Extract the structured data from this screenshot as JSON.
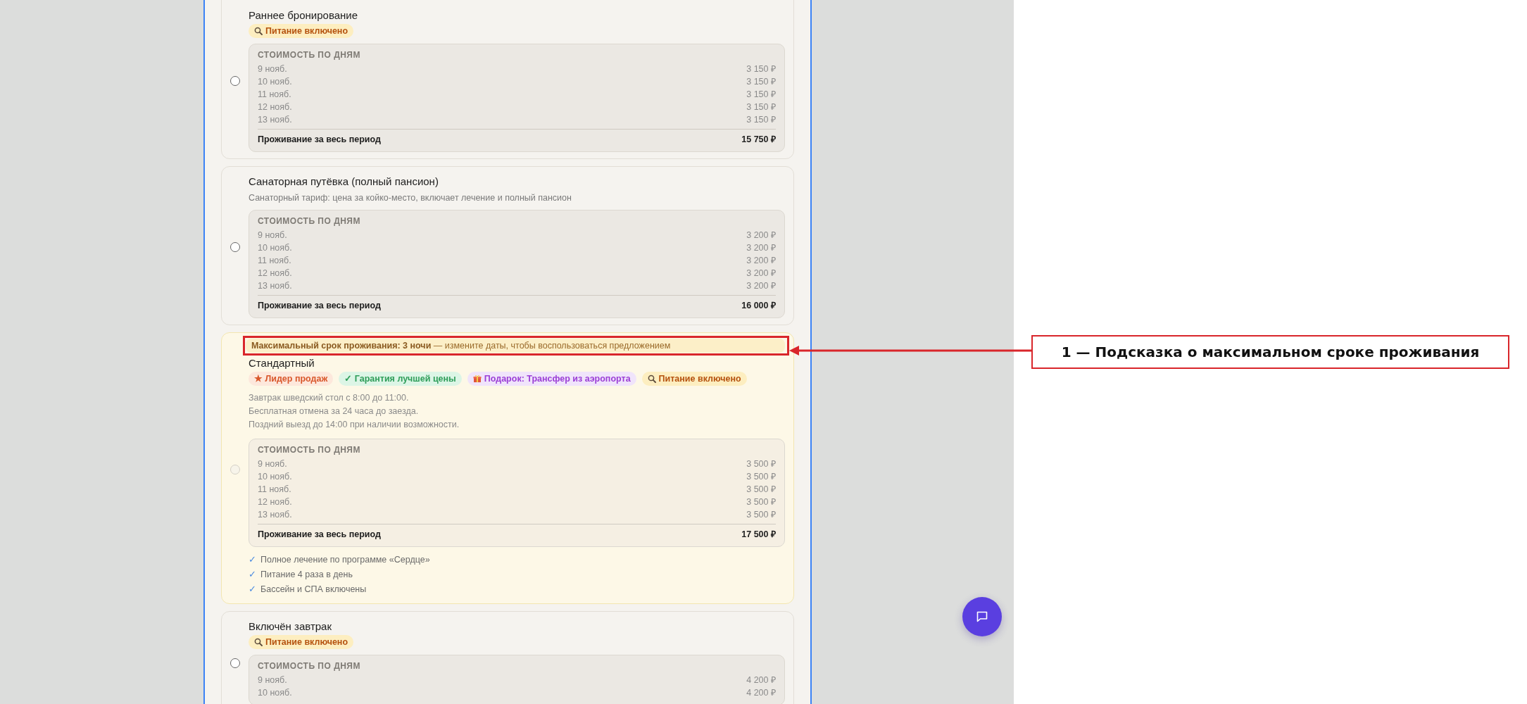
{
  "rates": [
    {
      "title": "Раннее бронирование",
      "selected": false,
      "disabled": false,
      "badges": [
        {
          "kind": "meal",
          "text": "Питание включено"
        }
      ],
      "prices": {
        "heading": "СТОИМОСТЬ ПО ДНЯМ",
        "days": [
          {
            "date": "9 нояб.",
            "price": "3 150 ₽"
          },
          {
            "date": "10 нояб.",
            "price": "3 150 ₽"
          },
          {
            "date": "11 нояб.",
            "price": "3 150 ₽"
          },
          {
            "date": "12 нояб.",
            "price": "3 150 ₽"
          },
          {
            "date": "13 нояб.",
            "price": "3 150 ₽"
          }
        ],
        "total_label": "Проживание за весь период",
        "total": "15 750 ₽"
      }
    },
    {
      "title": "Санаторная путёвка (полный пансион)",
      "selected": false,
      "disabled": false,
      "subtitle": "Санаторный тариф: цена за койко-место, включает лечение и полный пансион",
      "prices": {
        "heading": "СТОИМОСТЬ ПО ДНЯМ",
        "days": [
          {
            "date": "9 нояб.",
            "price": "3 200 ₽"
          },
          {
            "date": "10 нояб.",
            "price": "3 200 ₽"
          },
          {
            "date": "11 нояб.",
            "price": "3 200 ₽"
          },
          {
            "date": "12 нояб.",
            "price": "3 200 ₽"
          },
          {
            "date": "13 нояб.",
            "price": "3 200 ₽"
          }
        ],
        "total_label": "Проживание за весь период",
        "total": "16 000 ₽"
      }
    },
    {
      "title": "Стандартный",
      "selected": false,
      "disabled": true,
      "hint": {
        "label": "Максимальный срок проживания: 3 ночи",
        "text": "— измените даты, чтобы воспользоваться предложением"
      },
      "badges": [
        {
          "kind": "bestseller",
          "text": "★ Лидер продаж"
        },
        {
          "kind": "guarantee",
          "text": "✓ Гарантия лучшей цены"
        },
        {
          "kind": "gift",
          "text": "Подарок: Трансфер из аэропорта"
        },
        {
          "kind": "meal",
          "text": "Питание включено"
        }
      ],
      "description": [
        "Завтрак шведский стол с 8:00 до 11:00.",
        "Бесплатная отмена за 24 часа до заезда.",
        "Поздний выезд до 14:00 при наличии возможности."
      ],
      "prices": {
        "heading": "СТОИМОСТЬ ПО ДНЯМ",
        "days": [
          {
            "date": "9 нояб.",
            "price": "3 500 ₽"
          },
          {
            "date": "10 нояб.",
            "price": "3 500 ₽"
          },
          {
            "date": "11 нояб.",
            "price": "3 500 ₽"
          },
          {
            "date": "12 нояб.",
            "price": "3 500 ₽"
          },
          {
            "date": "13 нояб.",
            "price": "3 500 ₽"
          }
        ],
        "total_label": "Проживание за весь период",
        "total": "17 500 ₽"
      },
      "features": [
        {
          "check": "✓",
          "text": "Полное лечение по программе «Сердце»"
        },
        {
          "check": "✓",
          "text": "Питание 4 раза в день"
        },
        {
          "check": "✓",
          "text": "Бассейн и СПА включены"
        }
      ]
    },
    {
      "title": "Включён завтрак",
      "selected": false,
      "disabled": false,
      "badges": [
        {
          "kind": "meal",
          "text": "Питание включено"
        }
      ],
      "prices": {
        "heading": "СТОИМОСТЬ ПО ДНЯМ",
        "days": [
          {
            "date": "9 нояб.",
            "price": "4 200 ₽"
          },
          {
            "date": "10 нояб.",
            "price": "4 200 ₽"
          }
        ]
      }
    }
  ],
  "annotation": {
    "label": "1 — Подсказка о максимальном сроке проживания"
  }
}
